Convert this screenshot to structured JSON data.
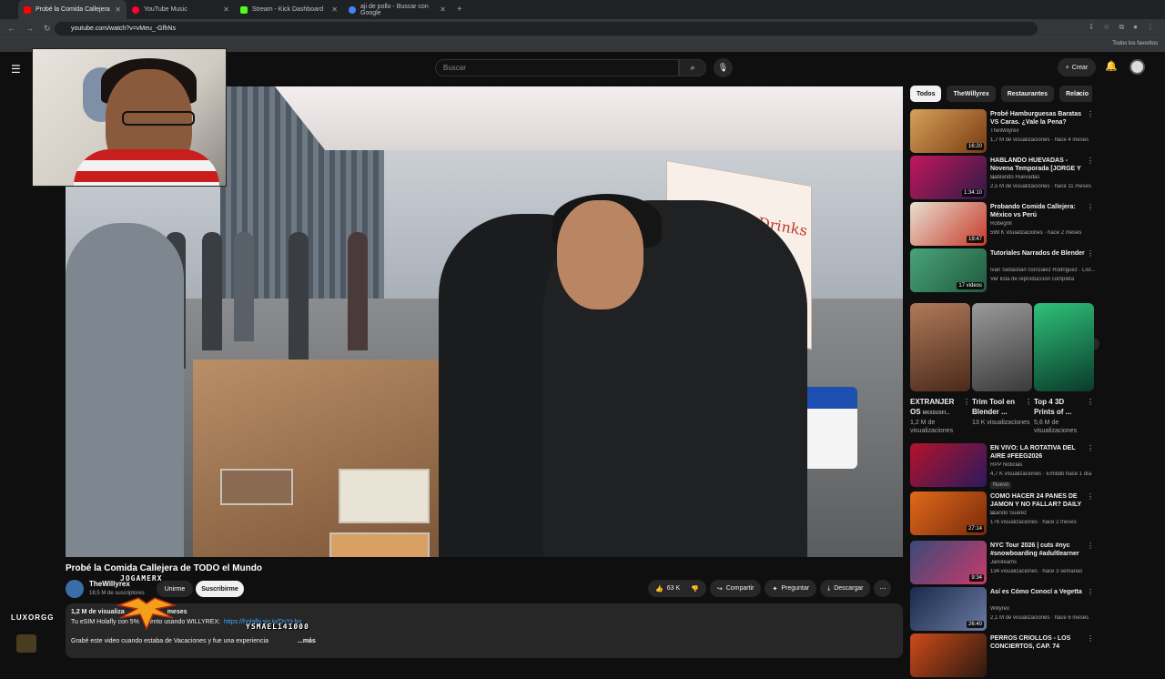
{
  "browser": {
    "tabs": [
      {
        "label": "Probé la Comida Callejera",
        "color": "#ff0000"
      },
      {
        "label": "YouTube Music",
        "color": "#ff0033"
      },
      {
        "label": "Stream - Kick Dashboard",
        "color": "#53fc18"
      },
      {
        "label": "aji de pollo - Buscar con Google",
        "color": "#4285f4"
      }
    ],
    "url": "youtube.com/watch?v=vMeu_-GfhNs",
    "bookmarks_label": "Todos los favoritos"
  },
  "header": {
    "search_placeholder": "Buscar",
    "create_label": "Crear"
  },
  "video": {
    "banner_text": "Specialty Drinks",
    "title": "Probé la Comida Callejera de TODO el Mundo",
    "channel": "TheWillyrex",
    "subscribers": "18,5 M de suscriptores",
    "join_label": "Unirme",
    "subscribe_label": "Suscribirme",
    "likes": "63 K",
    "share_label": "Compartir",
    "ask_label": "Preguntar",
    "download_label": "Descargar"
  },
  "description": {
    "line1": "1,2 M de visualiza",
    "line1_tail": "meses",
    "line2": "Tu eSIM Holafly con 5%",
    "line2_mid": "uento usando WILLYREX:",
    "link": "https://holafly.sjv.io/DyYt-bo",
    "line3": "Grabé este video cuando estaba de Vacaciones y fue una experiencia",
    "line3_tail": "...más"
  },
  "overlays": {
    "top_name": "JOGAMERX",
    "bottom_name": "YSMAEL141000",
    "side_logo": "LUXORGG"
  },
  "sidebar": {
    "chips": [
      "Todos",
      "TheWillyrex",
      "Restaurantes",
      "Relacio"
    ],
    "recs": [
      {
        "title": "Probé Hamburguesas Baratas VS Caras. ¿Vale la Pena?",
        "channel": "TheWillyrex",
        "meta": "1,7 M de visualizaciones · hace 4 meses",
        "duration": "16:20",
        "thumb": [
          "#d6a15a",
          "#7a3b12"
        ]
      },
      {
        "title": "HABLANDO HUEVADAS - Novena Temporada [JORGE Y ...",
        "channel": "Hablando Huevadas",
        "meta": "2,5 M de visualizaciones · hace 11 meses",
        "duration": "1:34:10",
        "thumb": [
          "#c2185b",
          "#2e1a47"
        ]
      },
      {
        "title": "Probando Comida Callejera: México vs Perú",
        "channel": "Robegrill",
        "meta": "599 K visualizaciones · hace 2 meses",
        "duration": "19:47",
        "thumb": [
          "#e8e0d0",
          "#c73a2a"
        ]
      },
      {
        "title": "Tutoriales Narrados de Blender",
        "channel": "Ivan Sebastian Gonzalez Rodriguez · List...",
        "meta": "Ver lista de reproducción completa",
        "duration": "17 videos",
        "thumb": [
          "#4aa37a",
          "#1f5b3f"
        ]
      },
      {
        "title": "EN VIVO: LA ROTATIVA DEL AIRE #FEEG2026",
        "channel": "RPP Noticias",
        "meta": "4,7 K visualizaciones · Emitido hace 1 día",
        "duration": "",
        "badge": "Nuevo",
        "thumb": [
          "#b3122a",
          "#2b1a5e"
        ]
      },
      {
        "title": "COMO HACER 24 PANES DE JAMON Y NO FALLAR? DAILY ...",
        "channel": "Brando Suarez",
        "meta": "176 visualizaciones · hace 2 meses",
        "duration": "27:14",
        "thumb": [
          "#e06a1b",
          "#7a2a0a"
        ]
      },
      {
        "title": "NYC Tour 2026 | cuts #nyc #snowboarding #adultlearner",
        "channel": "Jairoleams",
        "meta": "134 visualizaciones · hace 3 semanas",
        "duration": "9:34",
        "thumb": [
          "#3a4a7a",
          "#c93a6a"
        ]
      },
      {
        "title": "Así es Cómo Conocí a Vegetta",
        "channel": "Willyrex",
        "meta": "2,1 M de visualizaciones · hace 6 meses",
        "duration": "26:40",
        "thumb": [
          "#1a2a4a",
          "#6a7aa0"
        ]
      },
      {
        "title": "PERROS CRIOLLOS - LOS CONCIERTOS, CAP. 74",
        "channel": "",
        "meta": "",
        "duration": "",
        "thumb": [
          "#d14a1a",
          "#2a1a10"
        ]
      }
    ],
    "shorts": [
      {
        "title": "EXTRANJER OS",
        "tag": "MXXSUSFI...",
        "views": "1,2 M de visualizaciones",
        "thumb": [
          "#b07a5a",
          "#4a2a1a"
        ]
      },
      {
        "title": "Trim Tool en Blender ...",
        "tag": "",
        "views": "13 K visualizaciones",
        "thumb": [
          "#9a9a9a",
          "#3a3a3a"
        ]
      },
      {
        "title": "Top 4 3D Prints of ...",
        "tag": "",
        "views": "5,6 M de visualizaciones",
        "thumb": [
          "#2ec27a",
          "#0a3a2a"
        ]
      }
    ]
  }
}
